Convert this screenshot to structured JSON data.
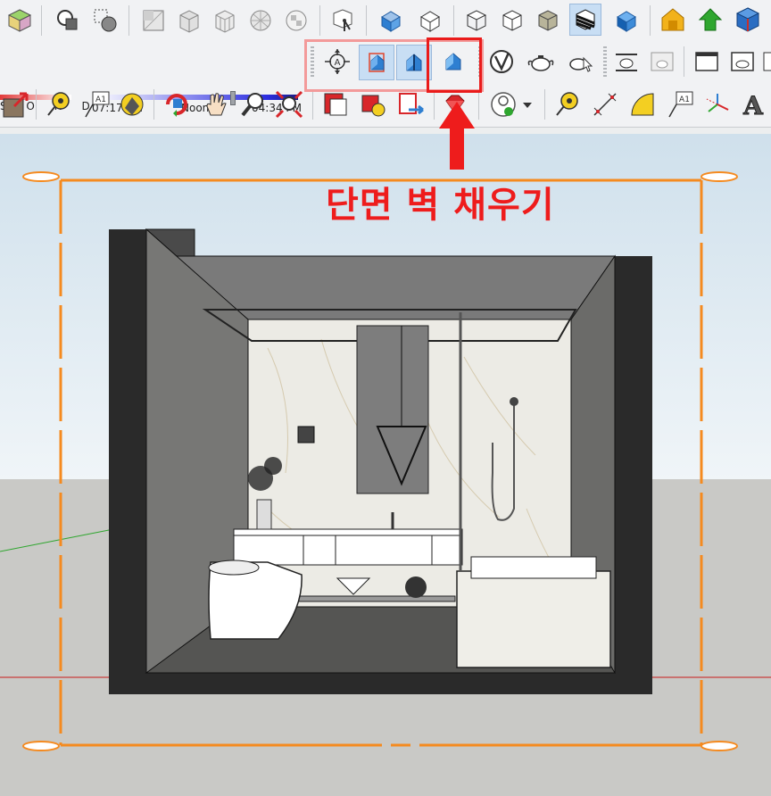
{
  "toolbar_row1": {
    "icons": [
      "solid-tools-icon",
      "outer-shell-icon",
      "intersect-icon",
      "xray-icon",
      "back-edges-icon",
      "wireframe-icon",
      "hidden-line-icon",
      "shaded-icon",
      "shaded-textures-icon",
      "monochrome-icon",
      "view-iso-icon",
      "view-top-icon",
      "view-front-icon",
      "view-right-icon",
      "view-back-icon",
      "view-left-icon",
      "warehouse-icon",
      "extension-warehouse-icon",
      "layout-icon"
    ]
  },
  "shadows": {
    "months_label": "S O N D",
    "time_start": "07:17 AM",
    "time_mid": "Noon",
    "time_end": "04:34 PM",
    "time_position": 0.68
  },
  "section_toolbar": {
    "section_plane_label": "A",
    "tools": [
      "section-plane-icon",
      "display-section-planes-icon",
      "display-section-cuts-icon",
      "display-section-fill-icon"
    ]
  },
  "row3": {
    "text_label": "A1",
    "dim_label": "A1",
    "threed_text_label": "A"
  },
  "annotation": {
    "callout": "단면 벽 채우기"
  },
  "colors": {
    "highlight_box": "#f39a9a",
    "callout_box": "#ea1b1b",
    "callout_text": "#ee1c1c",
    "section_plane": "#f58a1f",
    "pressed_button": "#c8def4"
  }
}
